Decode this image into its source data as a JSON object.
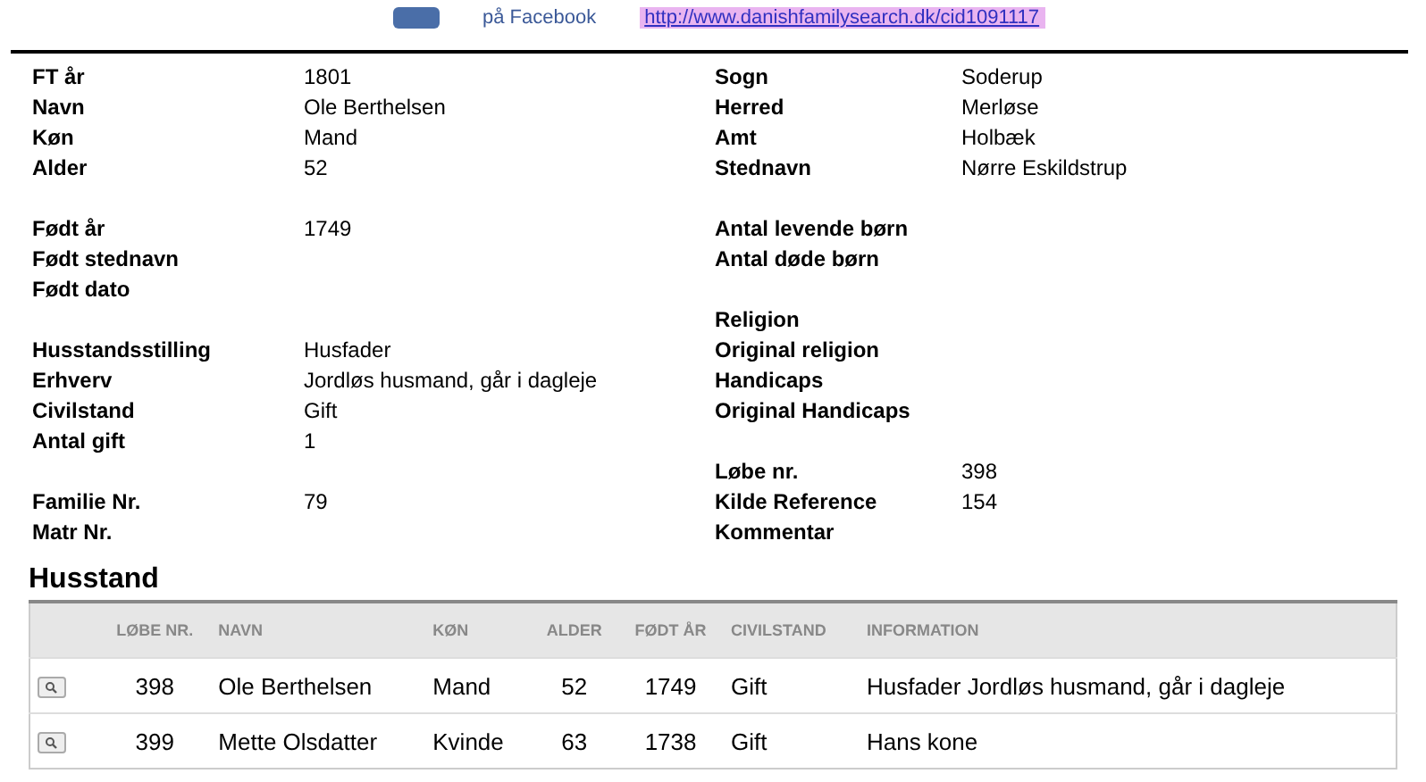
{
  "top_strip": {
    "facebook_text": "på Facebook",
    "link": "http://www.danishfamilysearch.dk/cid1091117"
  },
  "details": {
    "left": [
      [
        {
          "label": "FT år",
          "value": "1801"
        },
        {
          "label": "Navn",
          "value": "Ole Berthelsen"
        },
        {
          "label": "Køn",
          "value": "Mand"
        },
        {
          "label": "Alder",
          "value": "52"
        }
      ],
      [
        {
          "label": "Født år",
          "value": "1749"
        },
        {
          "label": "Født stednavn"
        },
        {
          "label": "Født dato"
        }
      ],
      [
        {
          "label": "Husstandsstilling",
          "value": "Husfader"
        },
        {
          "label": "Erhverv",
          "value": "Jordløs husmand, går i dagleje"
        },
        {
          "label": "Civilstand",
          "value": "Gift"
        },
        {
          "label": "Antal gift",
          "value": "1"
        }
      ],
      [
        {
          "label": "Familie Nr.",
          "value": "79"
        },
        {
          "label": "Matr Nr."
        }
      ]
    ],
    "right": [
      [
        {
          "label": "Sogn",
          "value": "Soderup"
        },
        {
          "label": "Herred",
          "value": "Merløse"
        },
        {
          "label": "Amt",
          "value": "Holbæk"
        },
        {
          "label": "Stednavn",
          "value": "Nørre Eskildstrup"
        }
      ],
      [
        {
          "label": "Antal levende børn"
        },
        {
          "label": "Antal døde børn"
        }
      ],
      [
        {
          "label": "Religion"
        },
        {
          "label": "Original religion"
        },
        {
          "label": "Handicaps"
        },
        {
          "label": "Original Handicaps"
        }
      ],
      [
        {
          "label": "Løbe nr.",
          "value": "398"
        },
        {
          "label": "Kilde Reference",
          "value": "154"
        },
        {
          "label": "Kommentar"
        }
      ]
    ]
  },
  "household": {
    "title": "Husstand",
    "columns": [
      "LØBE NR.",
      "NAVN",
      "KØN",
      "ALDER",
      "FØDT ÅR",
      "CIVILSTAND",
      "INFORMATION"
    ],
    "rows": [
      [
        "398",
        "Ole Berthelsen",
        "Mand",
        "52",
        "1749",
        "Gift",
        "Husfader Jordløs husmand, går i dagleje"
      ],
      [
        "399",
        "Mette Olsdatter",
        "Kvinde",
        "63",
        "1738",
        "Gift",
        "Hans kone"
      ]
    ]
  }
}
